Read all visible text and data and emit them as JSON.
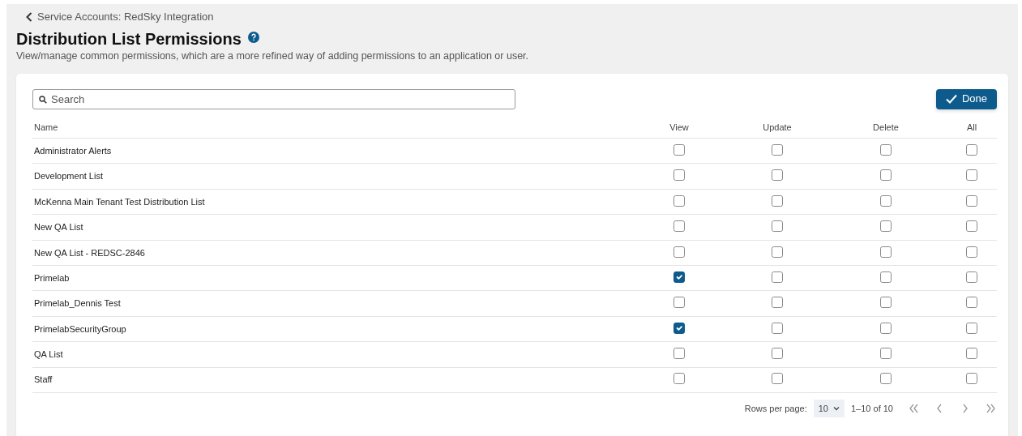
{
  "breadcrumb": {
    "label": "Service Accounts: RedSky Integration"
  },
  "page": {
    "title": "Distribution List Permissions",
    "description": "View/manage common permissions, which are a more refined way of adding permissions to an application or user."
  },
  "search": {
    "placeholder": "Search"
  },
  "done_button": {
    "label": "Done"
  },
  "table": {
    "columns": [
      "Name",
      "View",
      "Update",
      "Delete",
      "All"
    ],
    "rows": [
      {
        "name": "Administrator Alerts",
        "checks": [
          {
            "checked": false
          },
          {
            "checked": false
          },
          {
            "checked": false
          },
          {
            "checked": false
          }
        ]
      },
      {
        "name": "Development List",
        "checks": [
          {
            "checked": false
          },
          {
            "checked": false
          },
          {
            "checked": false
          },
          {
            "checked": false
          }
        ]
      },
      {
        "name": "McKenna Main Tenant Test Distribution List",
        "checks": [
          {
            "checked": false
          },
          {
            "checked": false
          },
          {
            "checked": false
          },
          {
            "checked": false
          }
        ]
      },
      {
        "name": "New QA List",
        "checks": [
          {
            "checked": false
          },
          {
            "checked": false
          },
          {
            "checked": false
          },
          {
            "checked": false
          }
        ]
      },
      {
        "name": "New QA List - REDSC-2846",
        "checks": [
          {
            "checked": false
          },
          {
            "checked": false
          },
          {
            "checked": false
          },
          {
            "checked": false
          }
        ]
      },
      {
        "name": "Primelab",
        "checks": [
          {
            "checked": true
          },
          {
            "checked": false
          },
          {
            "checked": false
          },
          {
            "checked": false
          }
        ]
      },
      {
        "name": "Primelab_Dennis Test",
        "checks": [
          {
            "checked": false
          },
          {
            "checked": false
          },
          {
            "checked": false
          },
          {
            "checked": false
          }
        ]
      },
      {
        "name": "PrimelabSecurityGroup",
        "checks": [
          {
            "checked": true
          },
          {
            "checked": false
          },
          {
            "checked": false
          },
          {
            "checked": false
          }
        ]
      },
      {
        "name": "QA List",
        "checks": [
          {
            "checked": false
          },
          {
            "checked": false
          },
          {
            "checked": false
          },
          {
            "checked": false
          }
        ]
      },
      {
        "name": "Staff",
        "checks": [
          {
            "checked": false
          },
          {
            "checked": false
          },
          {
            "checked": false
          },
          {
            "checked": false
          }
        ]
      }
    ]
  },
  "pagination": {
    "rows_per_page_label": "Rows per page:",
    "rows_per_page": "10",
    "range": "1–10 of 10"
  }
}
